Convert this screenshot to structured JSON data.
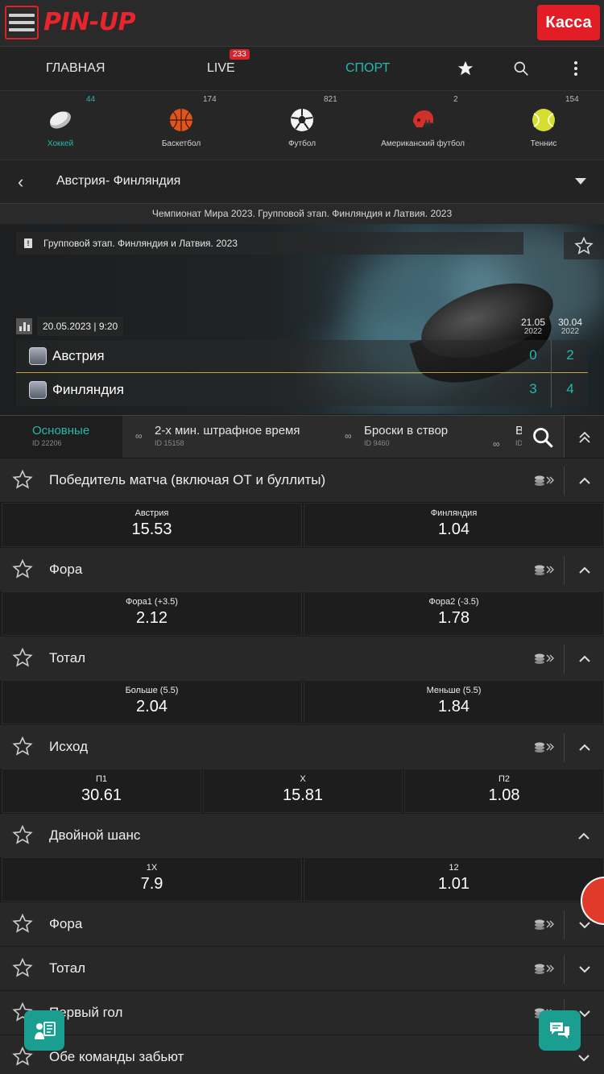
{
  "header": {
    "logo_text": "PIN-UP",
    "cashier_label": "Касса"
  },
  "nav": {
    "items": [
      {
        "label": "ГЛАВНАЯ"
      },
      {
        "label": "LIVE",
        "badge": "233"
      },
      {
        "label": "СПОРТ"
      }
    ],
    "icons": [
      "star-icon",
      "search-icon",
      "more-vertical-icon"
    ]
  },
  "sports": [
    {
      "name": "Хоккей",
      "count": "44",
      "icon": "hockey-puck-icon"
    },
    {
      "name": "Баскетбол",
      "count": "174",
      "icon": "basketball-icon"
    },
    {
      "name": "Футбол",
      "count": "821",
      "icon": "soccer-ball-icon"
    },
    {
      "name": "Американский футбол",
      "count": "2",
      "icon": "football-helmet-icon"
    },
    {
      "name": "Теннис",
      "count": "154",
      "icon": "tennis-ball-icon"
    }
  ],
  "match_selector": {
    "title": "Австрия- Финляндия"
  },
  "tournament_line": "Чемпионат Мира 2023. Групповой этап. Финляндия и Латвия. 2023",
  "banner": {
    "stage": "Групповой этап. Финляндия и Латвия. 2023",
    "datetime": "20.05.2023 | 9:20",
    "dates": [
      {
        "day": "21.05",
        "year": "2022"
      },
      {
        "day": "30.04",
        "year": "2022"
      }
    ],
    "teams": [
      {
        "name": "Австрия",
        "scores": [
          "0",
          "2"
        ]
      },
      {
        "name": "Финляндия",
        "scores": [
          "3",
          "4"
        ]
      }
    ]
  },
  "market_tabs": [
    {
      "name": "Основные",
      "id": "ID 22206"
    },
    {
      "name": "2-х мин. штрафное время",
      "id": "ID 15158"
    },
    {
      "name": "Броски в створ",
      "id": "ID 9460"
    },
    {
      "name": "В",
      "id": "ID"
    }
  ],
  "markets": [
    {
      "title": "Победитель матча (включая ОТ и буллиты)",
      "odds": [
        {
          "label": "Австрия",
          "value": "15.53"
        },
        {
          "label": "Финляндия",
          "value": "1.04"
        }
      ]
    },
    {
      "title": "Фора",
      "odds": [
        {
          "label": "Фора1 (+3.5)",
          "value": "2.12"
        },
        {
          "label": "Фора2 (-3.5)",
          "value": "1.78"
        }
      ]
    },
    {
      "title": "Тотал",
      "odds": [
        {
          "label": "Больше (5.5)",
          "value": "2.04"
        },
        {
          "label": "Меньше (5.5)",
          "value": "1.84"
        }
      ]
    },
    {
      "title": "Исход",
      "odds": [
        {
          "label": "П1",
          "value": "30.61"
        },
        {
          "label": "Х",
          "value": "15.81"
        },
        {
          "label": "П2",
          "value": "1.08"
        }
      ]
    },
    {
      "title": "Двойной шанс",
      "odds": [
        {
          "label": "1Х",
          "value": "7.9"
        },
        {
          "label": "12",
          "value": "1.01"
        }
      ]
    }
  ],
  "collapsed_markets": [
    {
      "title": "Фора"
    },
    {
      "title": "Тотал"
    },
    {
      "title": "Первый гол"
    },
    {
      "title": "Обе команды забьют"
    }
  ],
  "colors": {
    "accent": "#27b8ad",
    "brand_red": "#e21d25",
    "background": "#1b1b1b"
  }
}
